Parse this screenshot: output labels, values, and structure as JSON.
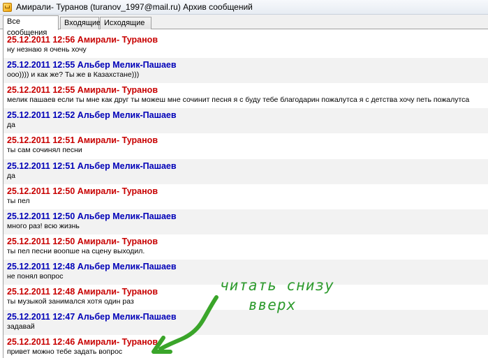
{
  "window": {
    "title": "Амирали- Туранов (turanov_1997@mail.ru) Архив сообщений"
  },
  "tabs": [
    {
      "label": "Все сообщения",
      "active": true
    },
    {
      "label": "Входящие",
      "active": false
    },
    {
      "label": "Исходящие",
      "active": false
    }
  ],
  "colors": {
    "sender_a": "#c80000",
    "sender_b": "#0000b8",
    "annotation": "#2e9b2e"
  },
  "messages": [
    {
      "header": "25.12.2011 12:56 Амирали- Туранов",
      "sender": "a",
      "text": "ну незнаю я очень хочу"
    },
    {
      "header": "25.12.2011 12:55 Альбер Мелик-Пашаев",
      "sender": "b",
      "text": "ооо)))) и как же? Ты же в Казахстане)))"
    },
    {
      "header": "25.12.2011 12:55 Амирали- Туранов",
      "sender": "a",
      "text": "мелик пашаев если ты мне как друг ты можеш мне сочинит песня я с буду тебе благодарин пожалутса я с детства хочу петь пожалутса"
    },
    {
      "header": "25.12.2011 12:52 Альбер Мелик-Пашаев",
      "sender": "b",
      "text": "да"
    },
    {
      "header": "25.12.2011 12:51 Амирали- Туранов",
      "sender": "a",
      "text": "ты сам сочинял песни"
    },
    {
      "header": "25.12.2011 12:51 Альбер Мелик-Пашаев",
      "sender": "b",
      "text": "да"
    },
    {
      "header": "25.12.2011 12:50 Амирали- Туранов",
      "sender": "a",
      "text": "ты пел"
    },
    {
      "header": "25.12.2011 12:50 Альбер Мелик-Пашаев",
      "sender": "b",
      "text": "много раз! всю жизнь"
    },
    {
      "header": "25.12.2011 12:50 Амирали- Туранов",
      "sender": "a",
      "text": "ты пел песни воопше на сцену выходил."
    },
    {
      "header": "25.12.2011 12:48 Альбер Мелик-Пашаев",
      "sender": "b",
      "text": "не понял вопрос"
    },
    {
      "header": "25.12.2011 12:48 Амирали- Туранов",
      "sender": "a",
      "text": "ты музыкой занимался хотя один раз"
    },
    {
      "header": "25.12.2011 12:47 Альбер Мелик-Пашаев",
      "sender": "b",
      "text": "задавай"
    },
    {
      "header": "25.12.2011 12:46 Амирали- Туранов",
      "sender": "a",
      "text": "привет можно тебе задать вопрос"
    }
  ],
  "annotation": {
    "line1": "читать снизу",
    "line2": "вверх",
    "arrow_icon": "hand-drawn-arrow-icon"
  }
}
